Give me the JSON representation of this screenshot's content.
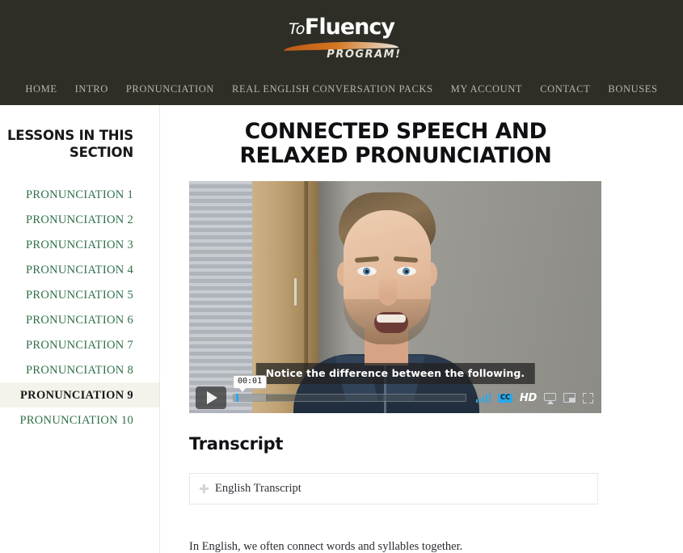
{
  "site": {
    "logo": {
      "word_to": "To",
      "word_fluency": "Fluency",
      "word_program": "PROGRAM!",
      "swoosh_color": "#c4671b",
      "header_bg": "#2e2e26"
    },
    "nav": {
      "items": [
        {
          "label": "HOME"
        },
        {
          "label": "INTRO"
        },
        {
          "label": "PRONUNCIATION"
        },
        {
          "label": "REAL ENGLISH CONVERSATION PACKS"
        },
        {
          "label": "MY ACCOUNT"
        },
        {
          "label": "CONTACT"
        },
        {
          "label": "BONUSES"
        }
      ]
    }
  },
  "sidebar": {
    "title": "LESSONS IN THIS SECTION",
    "link_color": "#2f7049",
    "active_bg": "#f3f3ec",
    "items": [
      {
        "label": "PRONUNCIATION 1",
        "active": false
      },
      {
        "label": "PRONUNCIATION 2",
        "active": false
      },
      {
        "label": "PRONUNCIATION 3",
        "active": false
      },
      {
        "label": "PRONUNCIATION 4",
        "active": false
      },
      {
        "label": "PRONUNCIATION 5",
        "active": false
      },
      {
        "label": "PRONUNCIATION 6",
        "active": false
      },
      {
        "label": "PRONUNCIATION 7",
        "active": false
      },
      {
        "label": "PRONUNCIATION 8",
        "active": false
      },
      {
        "label": "PRONUNCIATION 9",
        "active": true
      },
      {
        "label": "PRONUNCIATION 10",
        "active": false
      }
    ]
  },
  "main": {
    "page_title": "CONNECTED SPEECH AND RELAXED PRONUNCIATION",
    "video": {
      "caption_text": "Notice the difference between the following.",
      "current_time": "00:01",
      "play_icon": "play-icon",
      "quality_icon": "signal-bars-icon",
      "cc_label": "CC",
      "hd_label": "HD",
      "airplay_icon": "airplay-icon",
      "pip_icon": "picture-in-picture-icon",
      "fullscreen_icon": "fullscreen-icon",
      "accent_color": "#2ba8e8"
    },
    "transcript": {
      "heading": "Transcript",
      "accordion_label": "English Transcript",
      "expand_icon": "plus-icon"
    },
    "paragraph": "In English, we often connect words and syllables together."
  }
}
